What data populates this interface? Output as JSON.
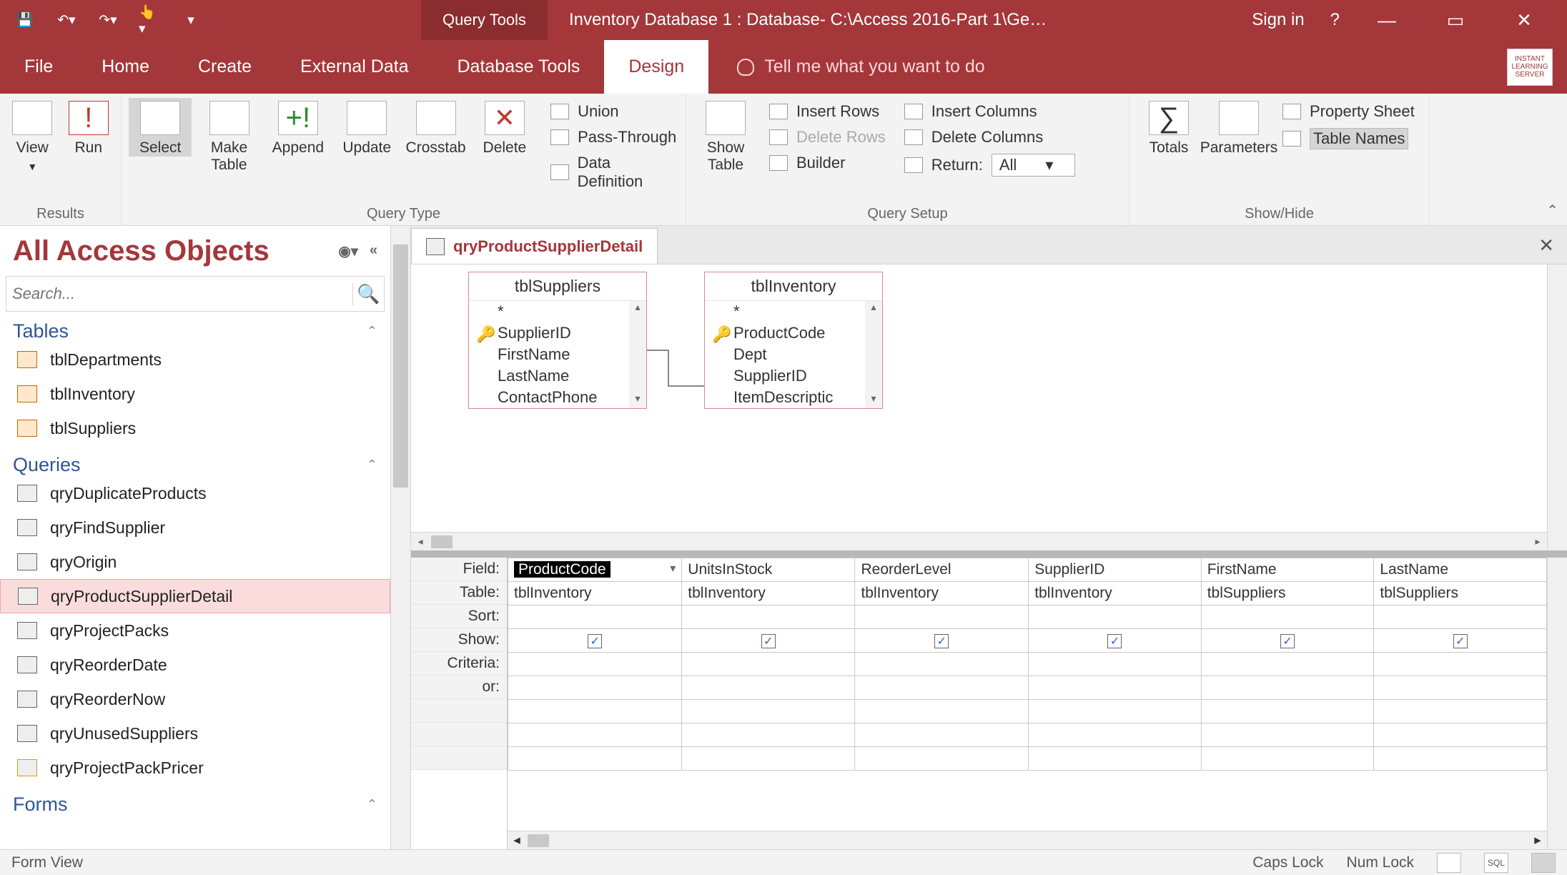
{
  "titlebar": {
    "contextual_label": "Query Tools",
    "window_title": "Inventory Database 1 : Database- C:\\Access 2016-Part 1\\Ge…",
    "signin": "Sign in",
    "help": "?"
  },
  "tabs": {
    "file": "File",
    "home": "Home",
    "create": "Create",
    "external": "External Data",
    "dbtools": "Database Tools",
    "design": "Design",
    "tellme": "Tell me what you want to do"
  },
  "ribbon": {
    "results": {
      "view": "View",
      "run": "Run",
      "label": "Results"
    },
    "qtype": {
      "select": "Select",
      "maketable": "Make\nTable",
      "append": "Append",
      "update": "Update",
      "crosstab": "Crosstab",
      "delete": "Delete",
      "union": "Union",
      "passthrough": "Pass-Through",
      "datadef": "Data Definition",
      "label": "Query Type"
    },
    "setup": {
      "showtable": "Show\nTable",
      "insertrows": "Insert Rows",
      "deleterows": "Delete Rows",
      "builder": "Builder",
      "insertcols": "Insert Columns",
      "deletecols": "Delete Columns",
      "return": "Return:",
      "return_value": "All",
      "label": "Query Setup"
    },
    "showhide": {
      "totals": "Totals",
      "params": "Parameters",
      "propsheet": "Property Sheet",
      "tablenames": "Table Names",
      "label": "Show/Hide"
    }
  },
  "nav": {
    "title": "All Access Objects",
    "search_placeholder": "Search...",
    "groups": {
      "tables": "Tables",
      "queries": "Queries",
      "forms": "Forms"
    },
    "tables": [
      "tblDepartments",
      "tblInventory",
      "tblSuppliers"
    ],
    "queries": [
      "qryDuplicateProducts",
      "qryFindSupplier",
      "qryOrigin",
      "qryProductSupplierDetail",
      "qryProjectPacks",
      "qryReorderDate",
      "qryReorderNow",
      "qryUnusedSuppliers",
      "qryProjectPackPricer"
    ],
    "selected_query": "qryProductSupplierDetail"
  },
  "doc": {
    "tab_name": "qryProductSupplierDetail"
  },
  "designer": {
    "tables": [
      {
        "name": "tblSuppliers",
        "fields": [
          "*",
          "SupplierID",
          "FirstName",
          "LastName",
          "ContactPhone"
        ],
        "pk": "SupplierID"
      },
      {
        "name": "tblInventory",
        "fields": [
          "*",
          "ProductCode",
          "Dept",
          "SupplierID",
          "ItemDescriptic"
        ],
        "pk": "ProductCode"
      }
    ]
  },
  "grid": {
    "labels": {
      "field": "Field:",
      "table": "Table:",
      "sort": "Sort:",
      "show": "Show:",
      "criteria": "Criteria:",
      "or": "or:"
    },
    "cols": [
      {
        "field": "ProductCode",
        "table": "tblInventory",
        "show": true,
        "selected": true
      },
      {
        "field": "UnitsInStock",
        "table": "tblInventory",
        "show": true
      },
      {
        "field": "ReorderLevel",
        "table": "tblInventory",
        "show": true
      },
      {
        "field": "SupplierID",
        "table": "tblInventory",
        "show": true
      },
      {
        "field": "FirstName",
        "table": "tblSuppliers",
        "show": true
      },
      {
        "field": "LastName",
        "table": "tblSuppliers",
        "show": true
      }
    ]
  },
  "status": {
    "mode": "Form View",
    "caps": "Caps Lock",
    "num": "Num Lock"
  }
}
